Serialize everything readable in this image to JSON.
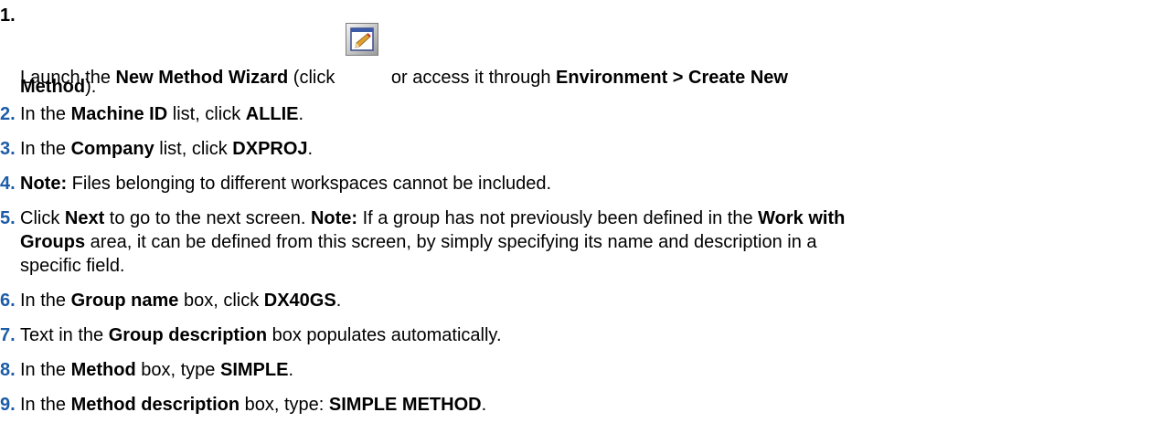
{
  "steps": [
    {
      "num": "1.",
      "parts": [
        {
          "t": "Launch the ",
          "b": false
        },
        {
          "t": "New Method Wizard",
          "b": true
        },
        {
          "t": " (click ",
          "b": false
        },
        {
          "icon": "wizard-icon"
        },
        {
          "t": "or access it through ",
          "b": false
        },
        {
          "t": "Environment > Create New",
          "b": true
        }
      ],
      "parts2": [
        {
          "t": "Method",
          "b": true
        },
        {
          "t": ").",
          "b": false
        }
      ]
    },
    {
      "num": "2.",
      "parts": [
        {
          "t": "In the ",
          "b": false
        },
        {
          "t": "Machine ID",
          "b": true
        },
        {
          "t": " list, click ",
          "b": false
        },
        {
          "t": "ALLIE",
          "b": true
        },
        {
          "t": ".",
          "b": false
        }
      ]
    },
    {
      "num": "3.",
      "parts": [
        {
          "t": "In the ",
          "b": false
        },
        {
          "t": "Company",
          "b": true
        },
        {
          "t": " list, click ",
          "b": false
        },
        {
          "t": "DXPROJ",
          "b": true
        },
        {
          "t": ".",
          "b": false
        }
      ]
    },
    {
      "num": "4.",
      "parts": [
        {
          "t": "Note:",
          "b": true
        },
        {
          "t": " Files belonging to different workspaces cannot be included.",
          "b": false
        }
      ]
    },
    {
      "num": "5.",
      "parts": [
        {
          "t": "Click ",
          "b": false
        },
        {
          "t": "Next",
          "b": true
        },
        {
          "t": " to go to the next screen. ",
          "b": false
        },
        {
          "t": "Note:",
          "b": true
        },
        {
          "t": " If a group has not previously been defined in the ",
          "b": false
        },
        {
          "t": "Work with",
          "b": true
        }
      ],
      "lines": [
        [
          {
            "t": "Groups",
            "b": true
          },
          {
            "t": " area, it can be defined from this screen, by simply specifying its name and description in a",
            "b": false
          }
        ],
        [
          {
            "t": "specific field.",
            "b": false
          }
        ]
      ]
    },
    {
      "num": "6.",
      "parts": [
        {
          "t": "In the ",
          "b": false
        },
        {
          "t": "Group name",
          "b": true
        },
        {
          "t": " box, click ",
          "b": false
        },
        {
          "t": "DX40GS",
          "b": true
        },
        {
          "t": ".",
          "b": false
        }
      ]
    },
    {
      "num": "7.",
      "parts": [
        {
          "t": "Text in the ",
          "b": false
        },
        {
          "t": "Group description",
          "b": true
        },
        {
          "t": " box populates automatically.",
          "b": false
        }
      ]
    },
    {
      "num": "8.",
      "parts": [
        {
          "t": "In the ",
          "b": false
        },
        {
          "t": "Method",
          "b": true
        },
        {
          "t": " box, type ",
          "b": false
        },
        {
          "t": "SIMPLE",
          "b": true
        },
        {
          "t": ".",
          "b": false
        }
      ]
    },
    {
      "num": "9.",
      "parts": [
        {
          "t": "In the ",
          "b": false
        },
        {
          "t": "Method description",
          "b": true
        },
        {
          "t": " box, type: ",
          "b": false
        },
        {
          "t": "SIMPLE METHOD",
          "b": true
        },
        {
          "t": ".",
          "b": false
        }
      ]
    }
  ],
  "colors": {
    "number_blue": "#1c5ca8",
    "text": "#000000"
  }
}
